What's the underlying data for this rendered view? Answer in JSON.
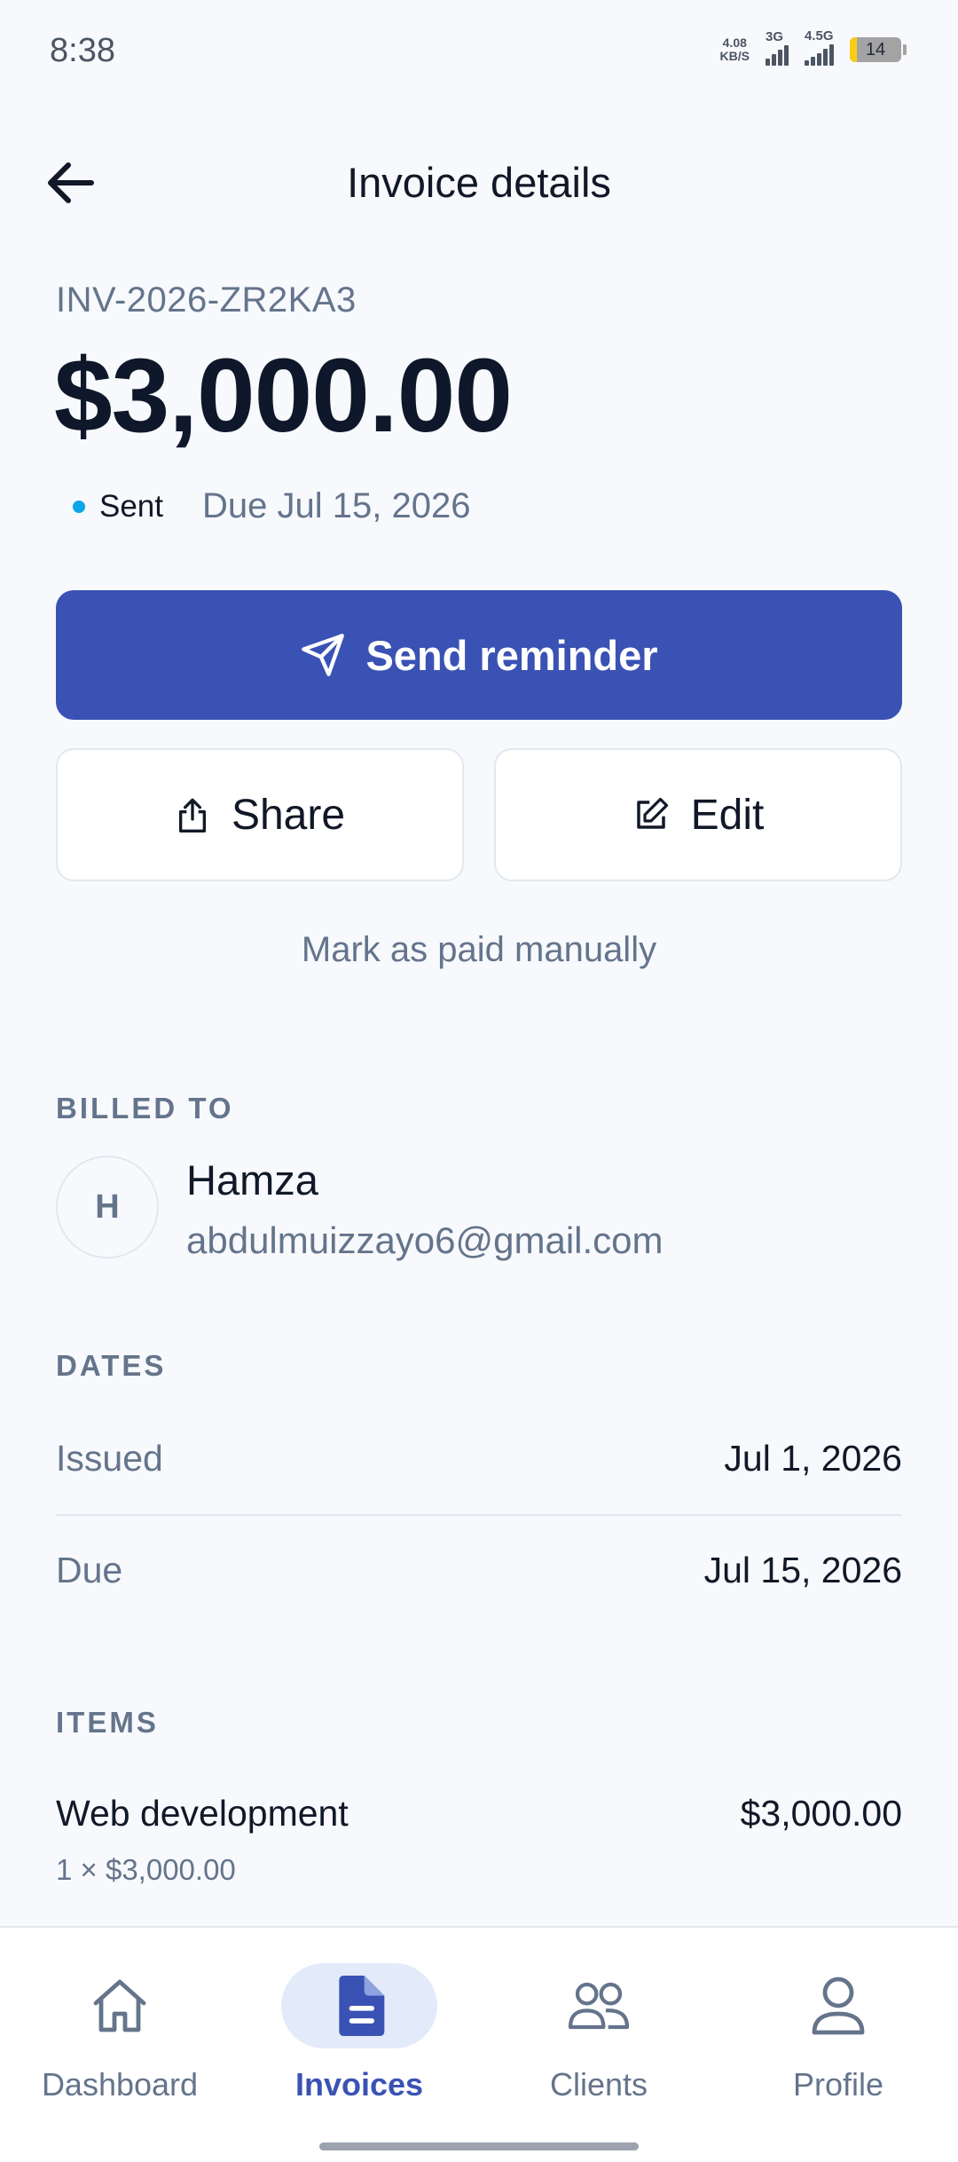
{
  "status_bar": {
    "time": "8:38",
    "net_speed_value": "4.08",
    "net_speed_unit": "KB/S",
    "signal1_label": "3G",
    "signal2_label": "4.5G",
    "battery_level": "14"
  },
  "header": {
    "title": "Invoice details"
  },
  "invoice": {
    "number": "INV-2026-ZR2KA3",
    "amount": "$3,000.00",
    "status": "Sent",
    "due_text": "Due Jul 15, 2026",
    "status_color": "#0EA5E9"
  },
  "actions": {
    "send_reminder": "Send reminder",
    "share": "Share",
    "edit": "Edit",
    "mark_paid": "Mark as paid manually"
  },
  "billed_to": {
    "label": "BILLED TO",
    "initial": "H",
    "name": "Hamza",
    "email": "abdulmuizzayo6@gmail.com"
  },
  "dates": {
    "label": "DATES",
    "issued_label": "Issued",
    "issued_value": "Jul 1, 2026",
    "due_label": "Due",
    "due_value": "Jul 15, 2026"
  },
  "items": {
    "label": "ITEMS",
    "list": [
      {
        "name": "Web development",
        "detail": "1 × $3,000.00",
        "total": "$3,000.00"
      }
    ]
  },
  "nav": {
    "items": [
      {
        "label": "Dashboard",
        "icon": "home-icon"
      },
      {
        "label": "Invoices",
        "icon": "document-icon",
        "active": true
      },
      {
        "label": "Clients",
        "icon": "users-icon"
      },
      {
        "label": "Profile",
        "icon": "user-icon"
      }
    ]
  },
  "colors": {
    "primary": "#3A52B4",
    "active_nav_bg": "#E3EBFA",
    "muted_text": "#64748B",
    "background": "#F7F9FC"
  }
}
